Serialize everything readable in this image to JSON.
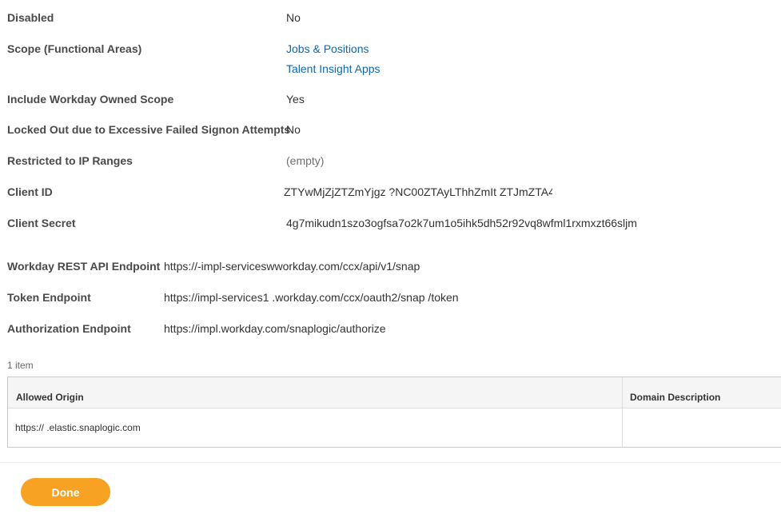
{
  "fields": {
    "disabled": {
      "label": "Disabled",
      "value": "No"
    },
    "scope": {
      "label": "Scope (Functional Areas)",
      "values": [
        "Jobs & Positions",
        "Talent Insight Apps"
      ]
    },
    "include_owned_scope": {
      "label": "Include Workday Owned Scope",
      "value": "Yes"
    },
    "locked_out": {
      "label": "Locked Out due to Excessive Failed Signon Attempts",
      "value": "No"
    },
    "restricted_ip": {
      "label": "Restricted to IP Ranges",
      "value": "(empty)"
    },
    "client_id": {
      "label": "Client ID",
      "value": "ZTYwMjZjZTZmYjgz  ?NC00ZTAyLThhZmIt ZTJmZTA4"
    },
    "client_secret": {
      "label": "Client Secret",
      "value": "4g7mikudn1szo3ogfsa7o2k7um1o5ihk5dh52r92vq8wfml1rxmxzt66sljm"
    }
  },
  "endpoints": {
    "rest_api": {
      "label": "Workday REST API Endpoint",
      "value": "https://-impl-serviceswworkday.com/ccx/api/v1/snap"
    },
    "token": {
      "label": "Token Endpoint",
      "value": "https://impl-services1  .workday.com/ccx/oauth2/snap /token"
    },
    "authorization": {
      "label": "Authorization Endpoint",
      "value": "https://impl.workday.com/snaplogic/authorize"
    }
  },
  "grid": {
    "count": "1 item",
    "columns": [
      "Allowed Origin",
      "Domain Description"
    ],
    "rows": [
      [
        "https://  .elastic.snaplogic.com",
        ""
      ]
    ]
  },
  "footer": {
    "done_label": "Done"
  },
  "colors": {
    "link": "#0b6ab1",
    "done_button": "#f7a222"
  }
}
